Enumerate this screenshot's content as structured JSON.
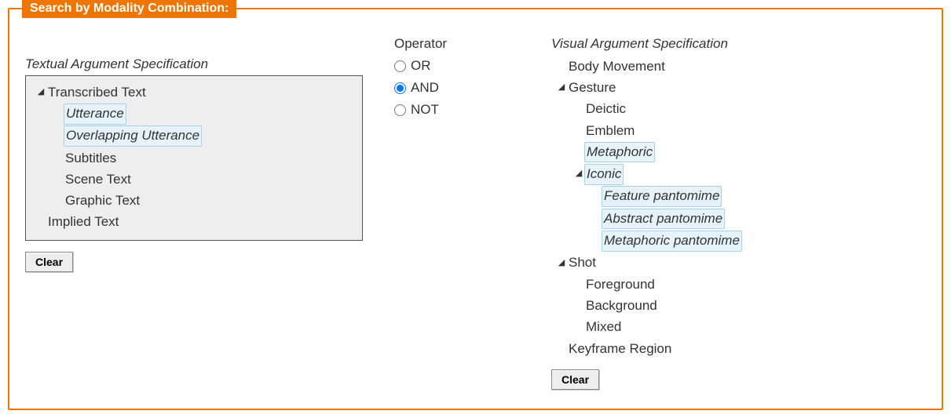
{
  "fieldset_title": "Search by Modality Combination:",
  "textual": {
    "heading": "Textual Argument Specification",
    "tree": {
      "transcribed": "Transcribed Text",
      "utterance": "Utterance",
      "overlapping": "Overlapping Utterance",
      "subtitles": "Subtitles",
      "scene": "Scene Text",
      "graphic": "Graphic Text",
      "implied": "Implied Text"
    },
    "clear": "Clear"
  },
  "operator": {
    "heading": "Operator",
    "or": "OR",
    "and": "AND",
    "not": "NOT",
    "selected": "and"
  },
  "visual": {
    "heading": "Visual Argument Specification",
    "tree": {
      "body": "Body Movement",
      "gesture": "Gesture",
      "deictic": "Deictic",
      "emblem": "Emblem",
      "metaphoric": "Metaphoric",
      "iconic": "Iconic",
      "feature_p": "Feature pantomime",
      "abstract_p": "Abstract pantomime",
      "metaphoric_p": "Metaphoric pantomime",
      "shot": "Shot",
      "foreground": "Foreground",
      "background": "Background",
      "mixed": "Mixed",
      "keyframe": "Keyframe Region"
    },
    "clear": "Clear"
  }
}
